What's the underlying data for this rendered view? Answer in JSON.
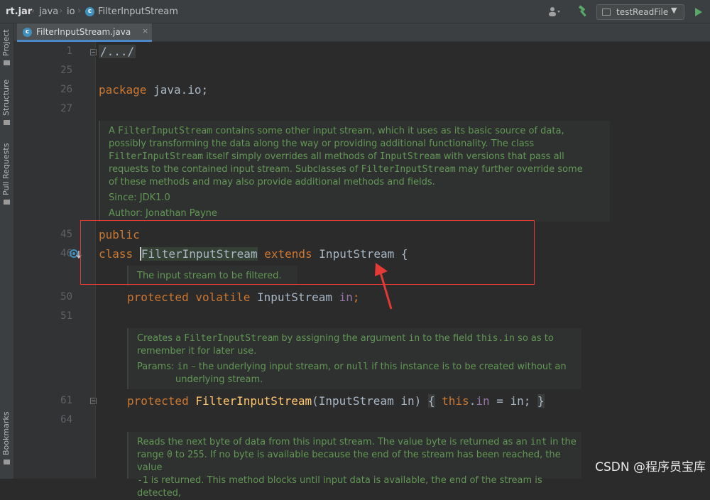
{
  "breadcrumb": {
    "items": [
      "rt.jar",
      "java",
      "io",
      "FilterInputStream"
    ]
  },
  "run_config": {
    "label": "testReadFile"
  },
  "tab": {
    "label": "FilterInputStream.java"
  },
  "left_strip": {
    "project": "Project",
    "structure": "Structure",
    "pull_requests": "Pull Requests",
    "bookmarks": "Bookmarks"
  },
  "gutter": {
    "line_numbers": [
      "1",
      "25",
      "26",
      "27",
      "45",
      "46",
      "50",
      "51",
      "61",
      "64"
    ]
  },
  "code": {
    "fold_header": "/.../",
    "package_kw": "package",
    "package_name": " java.io;",
    "public_kw": "public",
    "class_kw": "class",
    "class_name": "FilterInputStream",
    "extends_kw": "extends",
    "super_name": "InputStream",
    "brace": "{",
    "field_mods": "protected volatile",
    "field_type": "InputStream",
    "field_name": "in",
    "semi": ";",
    "ctor_kw": "protected",
    "ctor_name": "FilterInputStream",
    "ctor_params": "(InputStream in)",
    "body_open": "{",
    "this_kw": "this",
    "dot": ".",
    "in_ref": "in",
    "assign": " = in;",
    "body_close": "}"
  },
  "doc1": {
    "t1": "A ",
    "c1": "FilterInputStream",
    "t2": " contains some other input stream, which it uses as its basic source of data,",
    "l2": "possibly transforming the data along the way or providing additional functionality. The class",
    "c2": "FilterInputStream",
    "t3": " itself simply overrides all methods of ",
    "c3": "InputStream",
    "t4": " with versions that pass all",
    "t5": "requests to the contained input stream. Subclasses of ",
    "c4": "FilterInputStream",
    "t6": " may further override some",
    "l5": "of these methods and may also provide additional methods and fields.",
    "since": "Since:   JDK1.0",
    "author": "Author: Jonathan Payne"
  },
  "doc2": {
    "l1": "The input stream to be filtered."
  },
  "doc3": {
    "t1": "Creates a ",
    "c1": "FilterInputStream",
    "t2": " by assigning the argument ",
    "c2": "in",
    "t3": " to the field ",
    "c3": "this.in",
    "t4": " so as to",
    "l2": "remember it for later use.",
    "p_label": "Params: ",
    "p_name": "in",
    "p_text": " – the underlying input stream, or ",
    "c4": "null",
    "p_text2": " if this instance is to be created without an",
    "p_line2": "underlying stream."
  },
  "doc4": {
    "t1": "Reads the next byte of data from this input stream. The value byte is returned as an ",
    "c1": "int",
    "t2": " in the",
    "t3": "range ",
    "c2": "0",
    "t4": " to ",
    "c3": "255",
    "t5": ". If no byte is available because the end of the stream has been reached, the value",
    "c4": "-1",
    "t6": " is returned. This method blocks until input data is available, the end of the stream is detected,"
  },
  "watermark": {
    "text": "CSDN @程序员宝库"
  },
  "colors": {
    "keyword": "#cc7832",
    "doc_text": "#629755",
    "code_text": "#a9b7c6",
    "field": "#9876aa",
    "highlight_box": "#e53935",
    "arrow": "#e53935"
  }
}
